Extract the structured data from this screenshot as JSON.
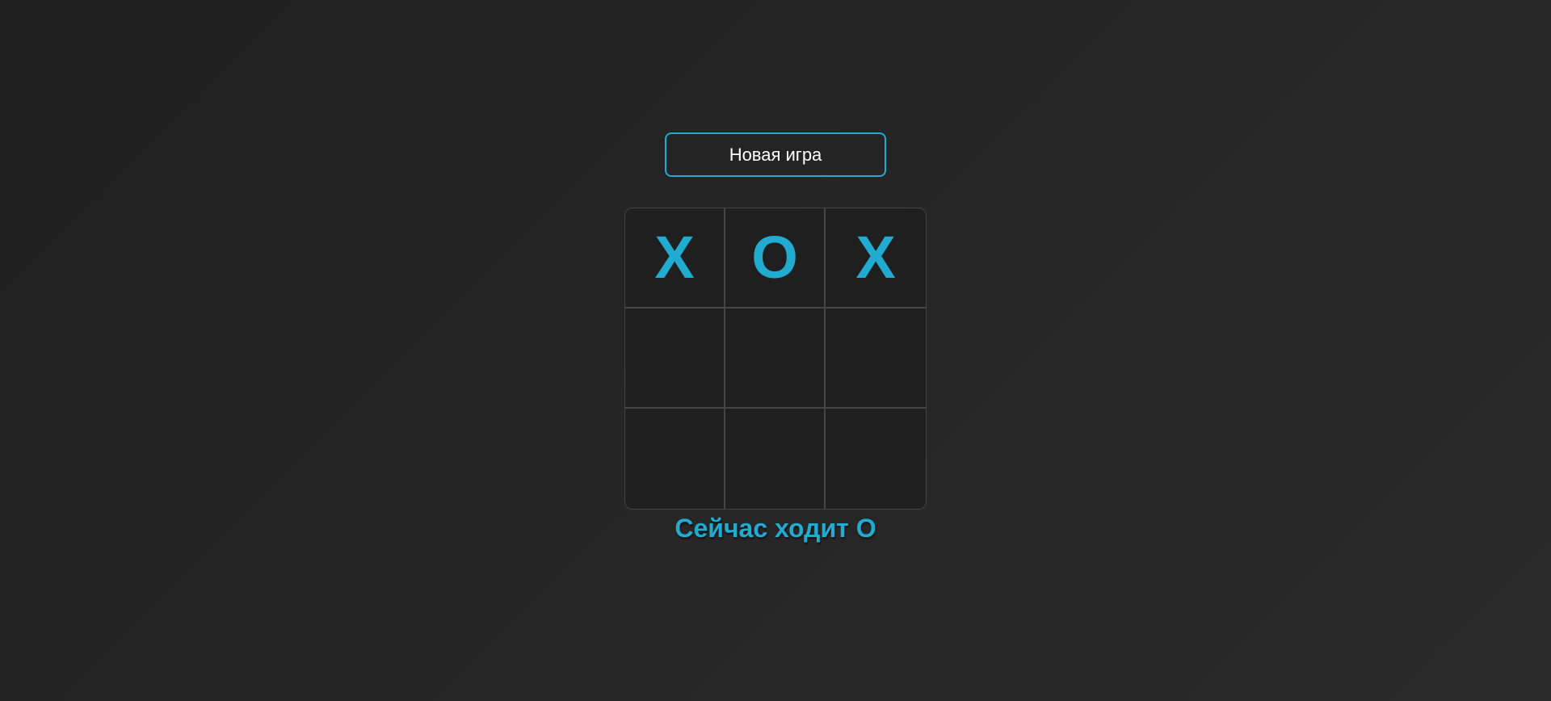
{
  "controls": {
    "new_game_label": "Новая игра"
  },
  "board": {
    "cells": [
      "X",
      "O",
      "X",
      "",
      "",
      "",
      "",
      "",
      ""
    ]
  },
  "status": {
    "text": "Сейчас ходит O"
  },
  "colors": {
    "accent": "#22abd0",
    "background": "#242424",
    "grid_line": "#454545"
  }
}
